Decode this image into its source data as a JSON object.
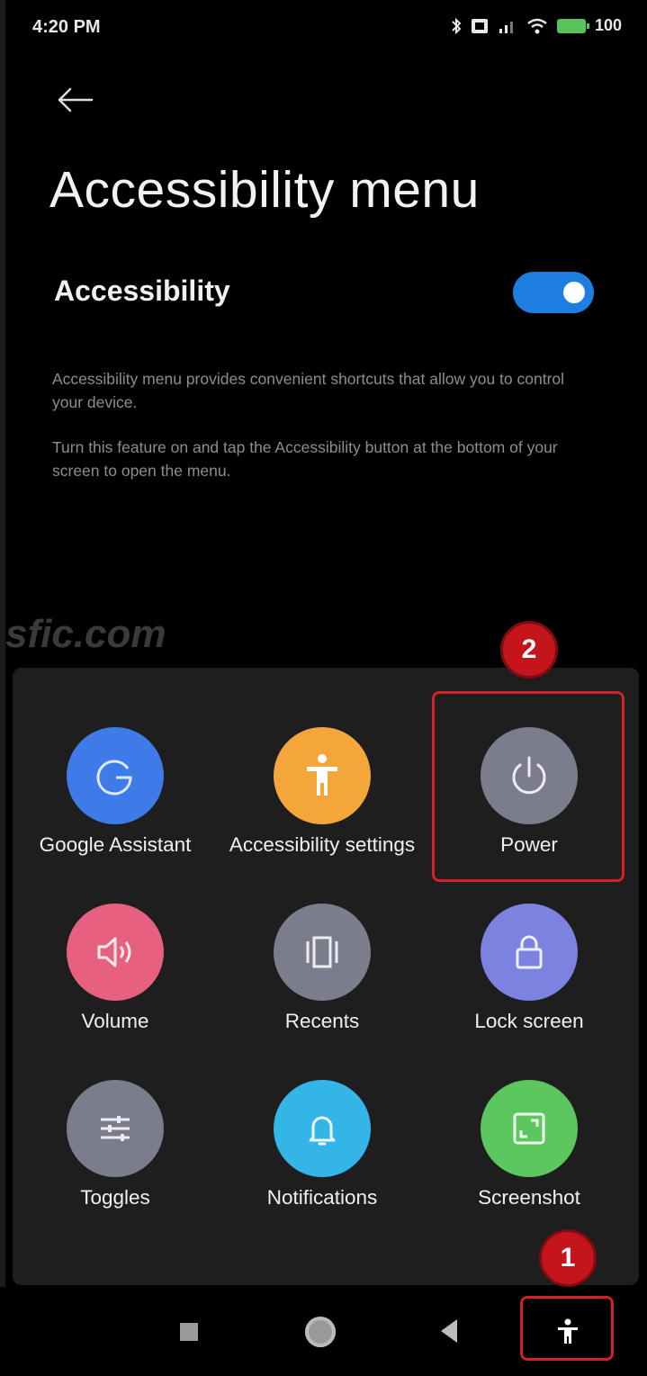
{
  "status_bar": {
    "time": "4:20 PM",
    "battery_level": "100"
  },
  "header": {
    "back_icon": "arrow-left-icon",
    "title": "Accessibility menu"
  },
  "setting": {
    "label": "Accessibility",
    "enabled": true,
    "toggle_color": "#1e7ee0"
  },
  "description": {
    "paragraph1": "Accessibility menu provides convenient shortcuts that allow you to control your device.",
    "paragraph2": "Turn this feature on and tap the Accessibility button at the bottom of your screen to open the menu."
  },
  "watermark": "sfic.com",
  "menu": {
    "tiles": [
      {
        "label": "Google Assistant",
        "icon": "google-g-icon",
        "color": "#3f7be8"
      },
      {
        "label": "Accessibility settings",
        "icon": "accessibility-person-icon",
        "color": "#f5a63b"
      },
      {
        "label": "Power",
        "icon": "power-icon",
        "color": "#7b7d8c"
      },
      {
        "label": "Volume",
        "icon": "volume-icon",
        "color": "#e8607f"
      },
      {
        "label": "Recents",
        "icon": "recents-icon",
        "color": "#7b7d8c"
      },
      {
        "label": "Lock screen",
        "icon": "lock-icon",
        "color": "#7b82e0"
      },
      {
        "label": "Toggles",
        "icon": "toggles-icon",
        "color": "#7b7d8c"
      },
      {
        "label": "Notifications",
        "icon": "bell-icon",
        "color": "#33b5e8"
      },
      {
        "label": "Screenshot",
        "icon": "screenshot-icon",
        "color": "#5cc75e"
      }
    ]
  },
  "annotations": {
    "badge1": "1",
    "badge2": "2",
    "highlight_color": "#d4202a"
  },
  "nav_bar": {
    "recents_icon": "square-icon",
    "home_icon": "circle-icon",
    "back_icon": "triangle-back-icon",
    "accessibility_icon": "accessibility-person-icon"
  }
}
